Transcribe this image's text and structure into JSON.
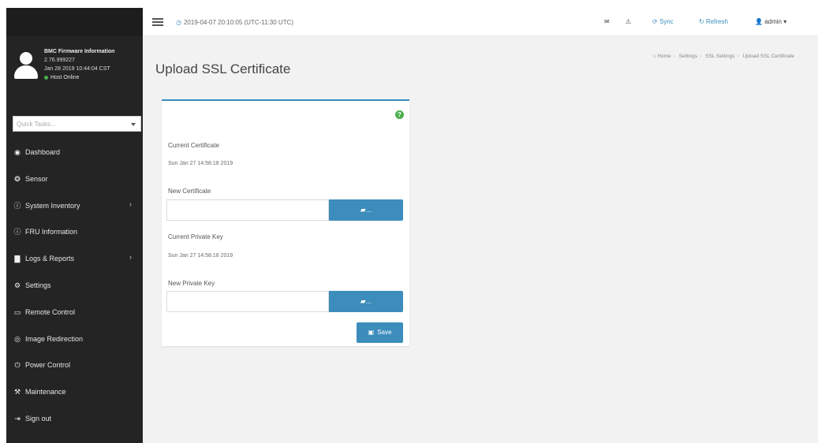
{
  "sidebar": {
    "user": {
      "title": "BMC Firmware Information",
      "version": "2.76.999227",
      "build_date": "Jan 28 2019 10:44:04 CST",
      "status": "Host Online"
    },
    "quick_tasks": {
      "placeholder": "Quick Tasks..."
    },
    "items": [
      {
        "label": "Dashboard",
        "icon": "dashboard-icon",
        "glyph": "◉",
        "arrow": ""
      },
      {
        "label": "Sensor",
        "icon": "sensor-icon",
        "glyph": "❂",
        "arrow": ""
      },
      {
        "label": "System Inventory",
        "icon": "info-icon",
        "glyph": "ⓘ",
        "arrow": "›"
      },
      {
        "label": "FRU Information",
        "icon": "info-icon",
        "glyph": "ⓘ",
        "arrow": ""
      },
      {
        "label": "Logs & Reports",
        "icon": "bar-chart-icon",
        "glyph": "▇",
        "arrow": "›"
      },
      {
        "label": "Settings",
        "icon": "gear-icon",
        "glyph": "⚙",
        "arrow": ""
      },
      {
        "label": "Remote Control",
        "icon": "monitor-icon",
        "glyph": "▭",
        "arrow": ""
      },
      {
        "label": "Image Redirection",
        "icon": "disc-icon",
        "glyph": "◎",
        "arrow": ""
      },
      {
        "label": "Power Control",
        "icon": "power-icon",
        "glyph": "⏻",
        "arrow": ""
      },
      {
        "label": "Maintenance",
        "icon": "wrench-icon",
        "glyph": "⚒",
        "arrow": ""
      },
      {
        "label": "Sign out",
        "icon": "sign-out-icon",
        "glyph": "⇥",
        "arrow": ""
      }
    ]
  },
  "header": {
    "datetime": "2019-04-07 20:10:05 (UTC-11:30 UTC)",
    "sync_label": "Sync",
    "refresh_label": "Refresh",
    "user_label": "admin"
  },
  "breadcrumb": [
    "Home",
    "Settings",
    "SSL Settings",
    "Upload SSL Certificate"
  ],
  "page": {
    "title": "Upload SSL Certificate",
    "current_certificate_label": "Current Certificate",
    "current_certificate_value": "Sun Jan 27 14:58:18 2019",
    "new_certificate_label": "New Certificate",
    "current_private_key_label": "Current Private Key",
    "current_private_key_value": "Sun Jan 27 14:58:18 2019",
    "new_private_key_label": "New Private Key",
    "browse_label": "...",
    "save_label": "Save"
  },
  "colors": {
    "accent": "#3c8dbc",
    "sidebar_bg": "#242424",
    "help": "#4caf50"
  }
}
